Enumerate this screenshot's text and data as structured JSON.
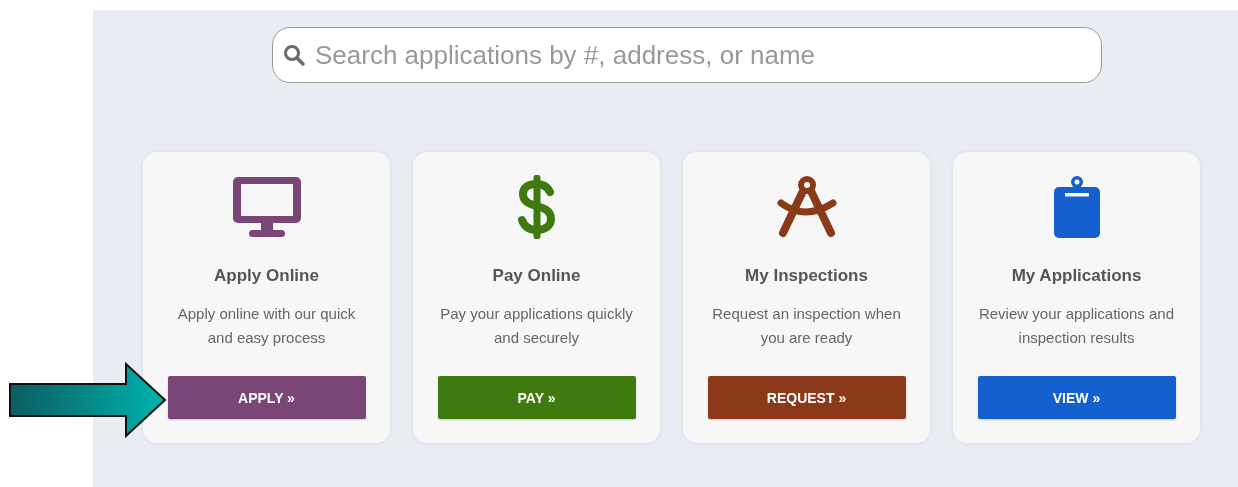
{
  "search": {
    "placeholder": "Search applications by #, address, or name"
  },
  "cards": [
    {
      "kind": "monitor",
      "color": "#7a4577",
      "title": "Apply Online",
      "description": "Apply online with our quick and easy process",
      "button": "APPLY »"
    },
    {
      "kind": "dollar",
      "color": "#3e7a0f",
      "title": "Pay Online",
      "description": "Pay your applications quickly and securely",
      "button": "PAY »"
    },
    {
      "kind": "compass",
      "color": "#8b3a19",
      "title": "My Inspections",
      "description": "Request an inspection when you are ready",
      "button": "REQUEST »"
    },
    {
      "kind": "clipboard",
      "color": "#1560cf",
      "title": "My Applications",
      "description": "Review your applications and inspection results",
      "button": "VIEW »"
    }
  ]
}
